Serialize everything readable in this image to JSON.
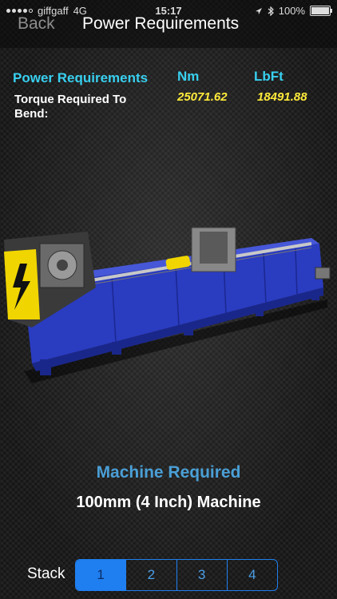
{
  "status_bar": {
    "carrier": "giffgaff",
    "network": "4G",
    "time": "15:17",
    "battery": "100%",
    "icons": [
      "signal-icon",
      "location-icon",
      "bluetooth-icon",
      "battery-icon"
    ]
  },
  "nav": {
    "back_label": "Back",
    "title": "Power Requirements"
  },
  "power": {
    "section_title": "Power Requirements",
    "torque_label": "Torque Required To Bend:",
    "units": {
      "nm": "Nm",
      "lbft": "LbFt"
    },
    "values": {
      "nm": "25071.62",
      "lbft": "18491.88"
    }
  },
  "machine": {
    "required_label": "Machine Required",
    "value": "100mm (4 Inch) Machine",
    "colors": {
      "body": "#2c3fc4",
      "accent": "#f0d500"
    }
  },
  "stack": {
    "label": "Stack",
    "options": [
      "1",
      "2",
      "3",
      "4"
    ],
    "selected": "1"
  },
  "colors": {
    "accent_cyan": "#38d0f0",
    "value_yellow": "#ffeb3b",
    "machine_blue": "#4a9fd6",
    "segment_blue": "#1f7ff0"
  }
}
